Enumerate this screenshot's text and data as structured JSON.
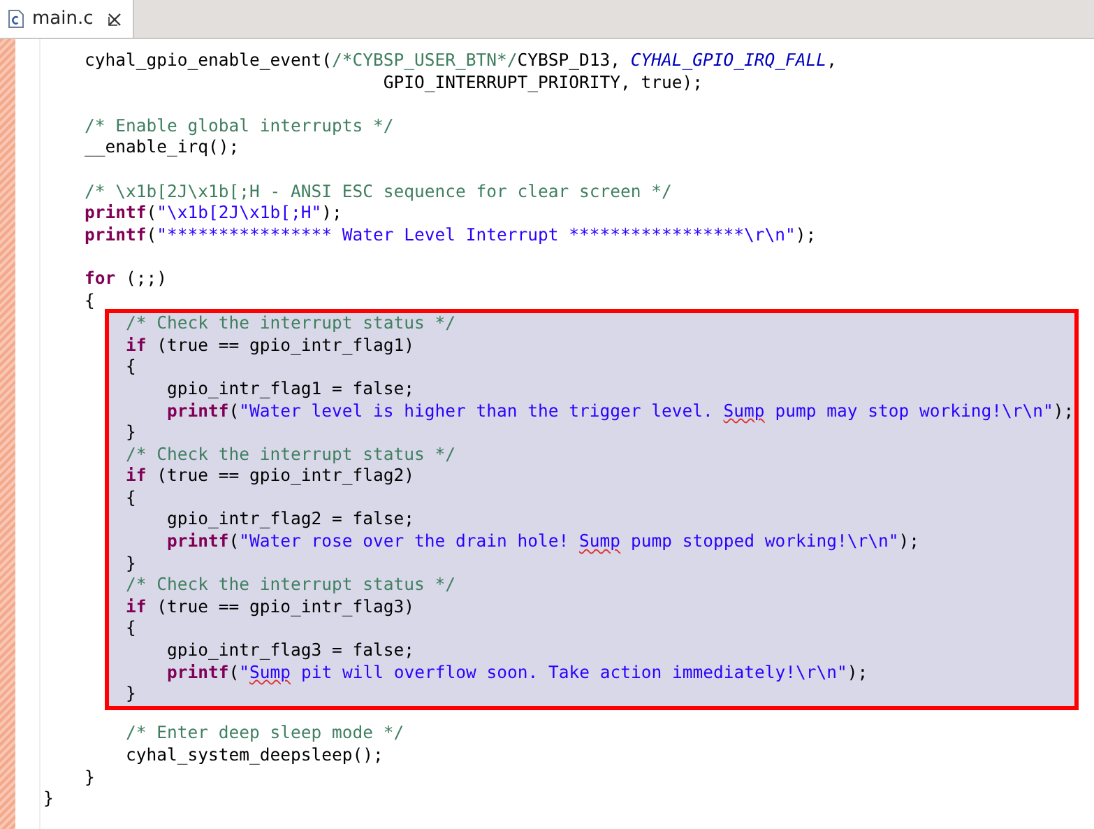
{
  "tabs": [
    {
      "label": "main.c",
      "selected": true
    }
  ],
  "code_before": [
    {
      "tokens": [
        {
          "kind": "plain",
          "text": "    cyhal_gpio_enable_event("
        },
        {
          "kind": "comment",
          "text": "/*CYBSP_USER_BTN*/"
        },
        {
          "kind": "plain",
          "text": "CYBSP_D13, "
        },
        {
          "kind": "constant",
          "text": "CYHAL_GPIO_IRQ_FALL"
        },
        {
          "kind": "plain",
          "text": ","
        }
      ]
    },
    {
      "tokens": [
        {
          "kind": "plain",
          "text": "                                 GPIO_INTERRUPT_PRIORITY, true);"
        }
      ]
    },
    {
      "kind": "blank"
    },
    {
      "kind": "code",
      "tokens": [
        {
          "kind": "comment",
          "text": "    /* Enable global interrupts */"
        }
      ]
    },
    {
      "tokens": [
        {
          "kind": "plain",
          "text": "    __enable_irq();"
        }
      ]
    },
    {
      "kind": "blank"
    },
    {
      "kind": "code",
      "tokens": [
        {
          "kind": "comment",
          "text": "    /* \\x1b[2J\\x1b[;H - ANSI ESC sequence for clear screen */"
        }
      ]
    },
    {
      "tokens": [
        {
          "kind": "keyword",
          "text": "    printf"
        },
        {
          "kind": "plain",
          "text": "("
        },
        {
          "kind": "string",
          "text": "\"\\x1b[2J\\x1b[;H\""
        },
        {
          "kind": "plain",
          "text": ");"
        }
      ]
    },
    {
      "tokens": [
        {
          "kind": "keyword",
          "text": "    printf"
        },
        {
          "kind": "plain",
          "text": "("
        },
        {
          "kind": "string",
          "text": "\"**************** Water Level Interrupt *****************\\r\\n\""
        },
        {
          "kind": "plain",
          "text": ");"
        }
      ]
    },
    {
      "kind": "blank"
    },
    {
      "kind": "code",
      "tokens": [
        {
          "kind": "keyword",
          "text": "    for"
        },
        {
          "kind": "plain",
          "text": " (;;)"
        }
      ]
    },
    {
      "tokens": [
        {
          "kind": "plain",
          "text": "    {"
        }
      ]
    }
  ],
  "highlighted_block": [
    {
      "tokens": [
        {
          "kind": "comment",
          "text": "        /* Check the interrupt status */"
        }
      ]
    },
    {
      "tokens": [
        {
          "kind": "keyword",
          "text": "        if"
        },
        {
          "kind": "plain",
          "text": " (true == gpio_intr_flag1)"
        }
      ]
    },
    {
      "tokens": [
        {
          "kind": "plain",
          "text": "        {"
        }
      ]
    },
    {
      "tokens": [
        {
          "kind": "plain",
          "text": "            gpio_intr_flag1 = false;"
        }
      ]
    },
    {
      "tokens": [
        {
          "kind": "keyword",
          "text": "            printf"
        },
        {
          "kind": "plain",
          "text": "("
        },
        {
          "kind": "string",
          "text": "\"Water level is higher than the trigger level. "
        },
        {
          "kind": "misspelled",
          "text": "Sump"
        },
        {
          "kind": "string",
          "text": " pump may stop working!\\r\\n\""
        },
        {
          "kind": "plain",
          "text": ");"
        }
      ]
    },
    {
      "tokens": [
        {
          "kind": "plain",
          "text": "        }"
        }
      ]
    },
    {
      "tokens": [
        {
          "kind": "comment",
          "text": "        /* Check the interrupt status */"
        }
      ]
    },
    {
      "tokens": [
        {
          "kind": "keyword",
          "text": "        if"
        },
        {
          "kind": "plain",
          "text": " (true == gpio_intr_flag2)"
        }
      ]
    },
    {
      "tokens": [
        {
          "kind": "plain",
          "text": "        {"
        }
      ]
    },
    {
      "tokens": [
        {
          "kind": "plain",
          "text": "            gpio_intr_flag2 = false;"
        }
      ]
    },
    {
      "tokens": [
        {
          "kind": "keyword",
          "text": "            printf"
        },
        {
          "kind": "plain",
          "text": "("
        },
        {
          "kind": "string",
          "text": "\"Water rose over the drain hole! "
        },
        {
          "kind": "misspelled",
          "text": "Sump"
        },
        {
          "kind": "string",
          "text": " pump stopped working!\\r\\n\""
        },
        {
          "kind": "plain",
          "text": ");"
        }
      ]
    },
    {
      "tokens": [
        {
          "kind": "plain",
          "text": "        }"
        }
      ]
    },
    {
      "tokens": [
        {
          "kind": "comment",
          "text": "        /* Check the interrupt status */"
        }
      ]
    },
    {
      "tokens": [
        {
          "kind": "keyword",
          "text": "        if"
        },
        {
          "kind": "plain",
          "text": " (true == gpio_intr_flag3)"
        }
      ]
    },
    {
      "tokens": [
        {
          "kind": "plain",
          "text": "        {"
        }
      ]
    },
    {
      "tokens": [
        {
          "kind": "plain",
          "text": "            gpio_intr_flag3 = false;"
        }
      ]
    },
    {
      "tokens": [
        {
          "kind": "keyword",
          "text": "            printf"
        },
        {
          "kind": "plain",
          "text": "("
        },
        {
          "kind": "string",
          "text": "\""
        },
        {
          "kind": "misspelled",
          "text": "Sump"
        },
        {
          "kind": "string",
          "text": " pit will overflow soon. Take action immediately!\\r\\n\""
        },
        {
          "kind": "plain",
          "text": ");"
        }
      ]
    },
    {
      "tokens": [
        {
          "kind": "plain",
          "text": "        }"
        }
      ]
    }
  ],
  "code_after": [
    {
      "kind": "blank"
    },
    {
      "kind": "code",
      "tokens": [
        {
          "kind": "comment",
          "text": "        /* Enter deep sleep mode */"
        }
      ]
    },
    {
      "tokens": [
        {
          "kind": "plain",
          "text": "        cyhal_system_deepsleep();"
        }
      ]
    },
    {
      "tokens": [
        {
          "kind": "plain",
          "text": "    }"
        }
      ]
    },
    {
      "tokens": [
        {
          "kind": "plain",
          "text": "}"
        }
      ]
    }
  ]
}
